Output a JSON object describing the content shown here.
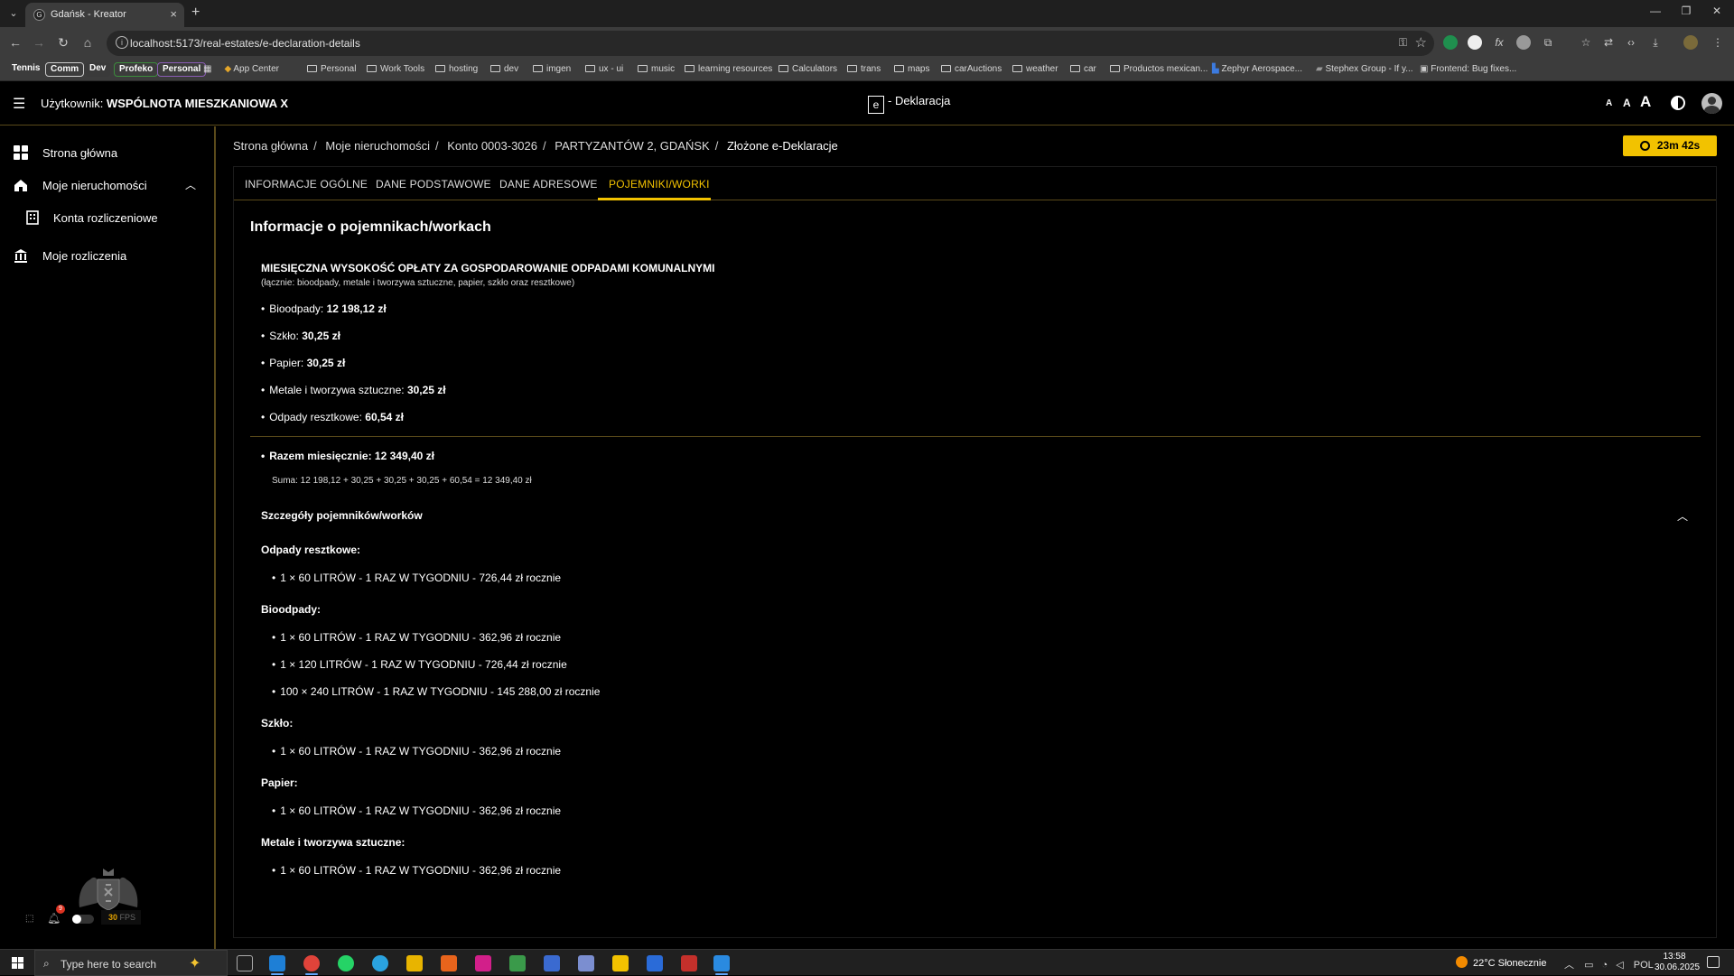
{
  "browser": {
    "tab_title": "Gdańsk - Kreator",
    "url": "localhost:5173/real-estates/e-declaration-details",
    "bookmarks_pills": [
      "Tennis",
      "Comm",
      "Dev",
      "Profeko",
      "Personal"
    ],
    "bookmarks": [
      "App Center",
      "Personal",
      "Work Tools",
      "hosting",
      "dev",
      "imgen",
      "ux - ui",
      "music",
      "learning resources",
      "Calculators",
      "trans",
      "maps",
      "carAuctions",
      "weather",
      "car",
      "Productos mexican...",
      "Zephyr Aerospace...",
      "Stephex Group - If y...",
      "Frontend: Bug fixes..."
    ]
  },
  "header": {
    "user_prefix": "Użytkownik:",
    "user_name": "WSPÓLNOTA MIESZKANIOWA X",
    "brand_box": "e",
    "brand_title": "- Deklaracja",
    "font_small": "A",
    "font_medium": "A",
    "font_large": "A"
  },
  "sidebar": {
    "items": [
      {
        "label": "Strona główna",
        "icon": "dashboard-icon"
      },
      {
        "label": "Moje nieruchomości",
        "icon": "house-icon"
      },
      {
        "label": "Konta rozliczeniowe",
        "icon": "building-icon"
      },
      {
        "label": "Moje rozliczenia",
        "icon": "bank-icon"
      }
    ],
    "fps_value": "30",
    "fps_label": "FPS",
    "notif_count": "9"
  },
  "breadcrumb": [
    "Strona główna",
    "Moje nieruchomości",
    "Konto 0003-3026",
    "PARTYZANTÓW 2, GDAŃSK",
    "Złożone e-Deklaracje"
  ],
  "timer": "23m 42s",
  "tabs": [
    "INFORMACJE OGÓLNE",
    "DANE PODSTAWOWE",
    "DANE ADRESOWE",
    "POJEMNIKI/WORKI"
  ],
  "active_tab": "POJEMNIKI/WORKI",
  "section": {
    "title": "Informacje o pojemnikach/workach",
    "summary_heading": "MIESIĘCZNA WYSOKOŚĆ OPŁATY ZA GOSPODAROWANIE ODPADAMI KOMUNALNYMI",
    "summary_sub": "(łącznie: bioodpady, metale i tworzywa sztuczne, papier, szkło oraz resztkowe)",
    "fees": [
      {
        "label": "Bioodpady:",
        "value": "12 198,12 zł"
      },
      {
        "label": "Szkło:",
        "value": "30,25 zł"
      },
      {
        "label": "Papier:",
        "value": "30,25 zł"
      },
      {
        "label": "Metale i tworzywa sztuczne:",
        "value": "30,25 zł"
      },
      {
        "label": "Odpady resztkowe:",
        "value": "60,54 zł"
      }
    ],
    "total": "Razem miesięcznie: 12 349,40 zł",
    "sum_line": "Suma: 12 198,12 + 30,25 + 30,25 + 30,25 + 60,54 = 12 349,40 zł",
    "details_heading": "Szczegóły pojemników/worków",
    "categories": [
      {
        "name": "Odpady resztkowe:",
        "items": [
          "1 × 60 LITRÓW - 1 RAZ W TYGODNIU - 726,44 zł rocznie"
        ]
      },
      {
        "name": "Bioodpady:",
        "items": [
          "1 × 60 LITRÓW - 1 RAZ W TYGODNIU - 362,96 zł rocznie",
          "1 × 120 LITRÓW - 1 RAZ W TYGODNIU - 726,44 zł rocznie",
          "100 × 240 LITRÓW - 1 RAZ W TYGODNIU - 145 288,00 zł rocznie"
        ]
      },
      {
        "name": "Szkło:",
        "items": [
          "1 × 60 LITRÓW - 1 RAZ W TYGODNIU - 362,96 zł rocznie"
        ]
      },
      {
        "name": "Papier:",
        "items": [
          "1 × 60 LITRÓW - 1 RAZ W TYGODNIU - 362,96 zł rocznie"
        ]
      },
      {
        "name": "Metale i tworzywa sztuczne:",
        "items": [
          "1 × 60 LITRÓW - 1 RAZ W TYGODNIU - 362,96 zł rocznie"
        ]
      }
    ]
  },
  "taskbar": {
    "search_placeholder": "Type here to search",
    "weather": "22°C  Słonecznie",
    "lang": "POL",
    "time": "13:58",
    "date": "30.06.2025"
  }
}
